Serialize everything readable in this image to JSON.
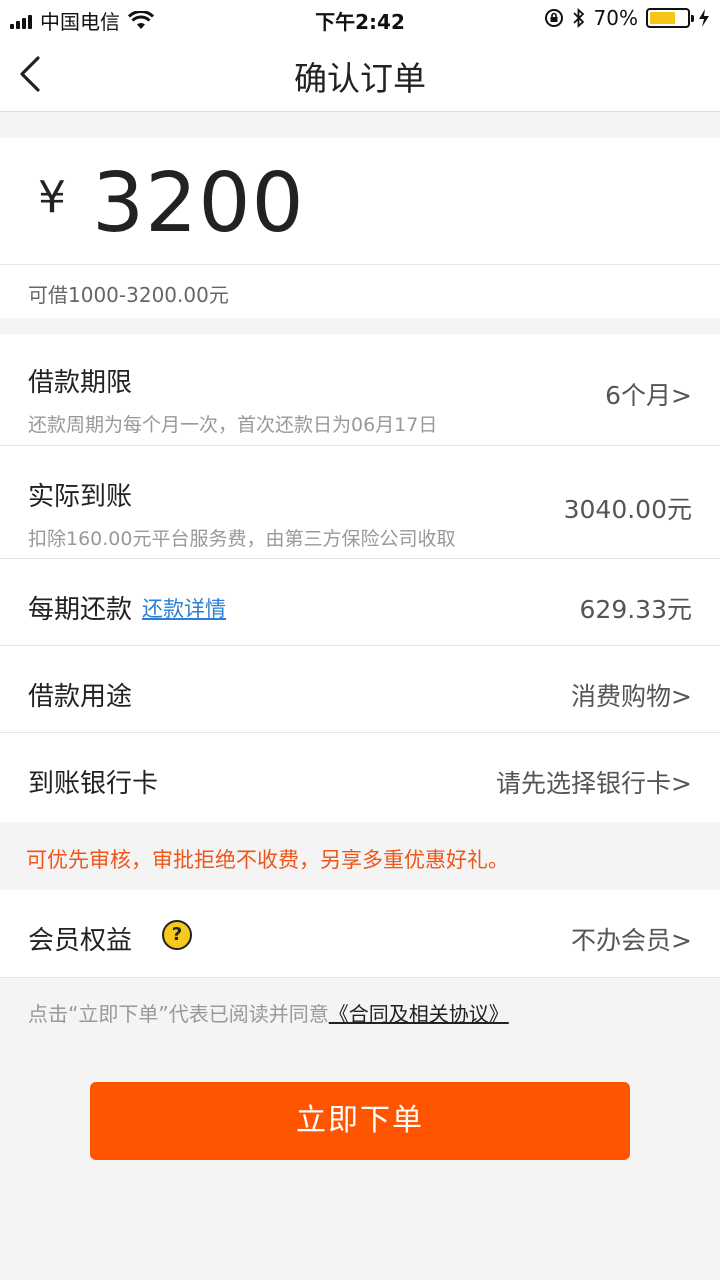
{
  "status_bar": {
    "carrier": "中国电信",
    "time": "下午2:42",
    "battery": "70%",
    "battery_level": 0.7
  },
  "nav": {
    "title": "确认订单"
  },
  "amount": {
    "currency": "¥",
    "value": "3200",
    "range": "可借1000-3200.00元"
  },
  "rows": {
    "term": {
      "label": "借款期限",
      "sub": "还款周期为每个月一次，首次还款日为06月17日",
      "value": "6个月>"
    },
    "received": {
      "label": "实际到账",
      "sub": "扣除160.00元平台服务费，由第三方保险公司收取",
      "value": "3040.00元"
    },
    "installment": {
      "label": "每期还款",
      "link": "还款详情",
      "value": "629.33元"
    },
    "purpose": {
      "label": "借款用途",
      "value": "消费购物>"
    },
    "bank_card": {
      "label": "到账银行卡",
      "value": "请先选择银行卡>"
    },
    "membership": {
      "label": "会员权益",
      "icon_glyph": "?",
      "value": "不办会员>"
    }
  },
  "notice": "可优先审核，审批拒绝不收费，另享多重优惠好礼。",
  "agreement": {
    "text": "点击“立即下单”代表已阅读并同意",
    "link": "《合同及相关协议》"
  },
  "submit_label": "立即下单",
  "colors": {
    "accent": "#ff5400",
    "notice": "#f0561a",
    "link": "#2b7fd8",
    "help_icon": "#f7c91c"
  }
}
